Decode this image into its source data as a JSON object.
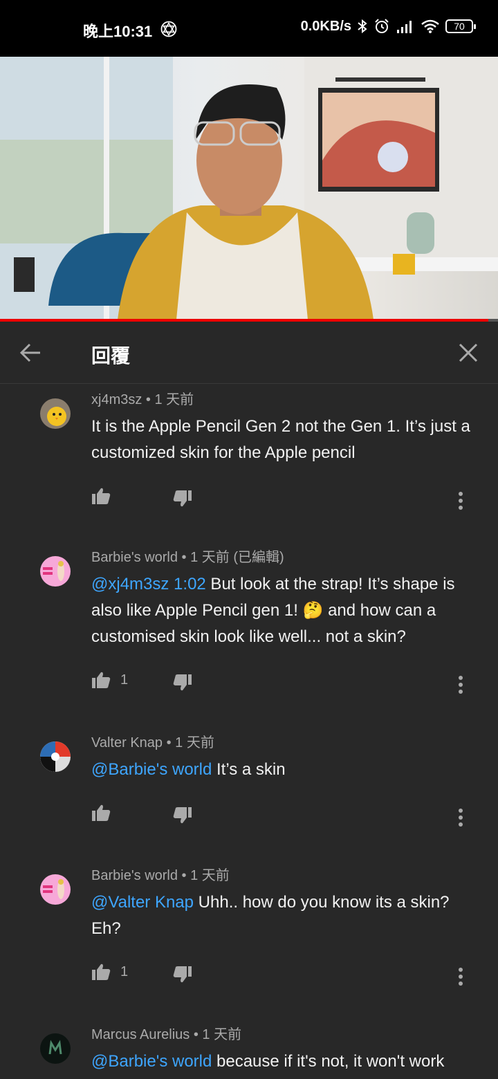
{
  "status_bar": {
    "time": "晚上10:31",
    "speed": "0.0KB/s",
    "battery": "70"
  },
  "video": {
    "progress_fraction": 0.98
  },
  "header": {
    "title": "回覆"
  },
  "comments": [
    {
      "author": "xj4m3sz",
      "time": "1 天前",
      "edited": "",
      "mention": "",
      "body": "It is the Apple Pencil Gen 2 not the Gen 1. It’s just a customized skin for the Apple pencil",
      "likes": ""
    },
    {
      "author": "Barbie's world",
      "time": "1 天前",
      "edited": "(已編輯)",
      "mention": "@xj4m3sz  1:02",
      "body": " But look at the strap! It’s shape is also like Apple Pencil gen 1! 🤔 and how can a customised skin look like well... not a skin?",
      "likes": "1"
    },
    {
      "author": "Valter Knap",
      "time": "1 天前",
      "edited": "",
      "mention": "@Barbie's world",
      "body": " It’s a skin",
      "likes": ""
    },
    {
      "author": "Barbie's world",
      "time": "1 天前",
      "edited": "",
      "mention": "@Valter Knap",
      "body": " Uhh.. how do you know its a skin? Eh?",
      "likes": "1"
    },
    {
      "author": "Marcus Aurelius",
      "time": "1 天前",
      "edited": "",
      "mention": "@Barbie's world",
      "body": " because if it's not, it won't work",
      "likes": ""
    }
  ],
  "colors": {
    "accent_link": "#3ea6ff",
    "progress": "#ee0000",
    "background": "#282828"
  },
  "icons": [
    "back-arrow-icon",
    "close-icon",
    "like-icon",
    "dislike-icon",
    "more-vert-icon"
  ]
}
